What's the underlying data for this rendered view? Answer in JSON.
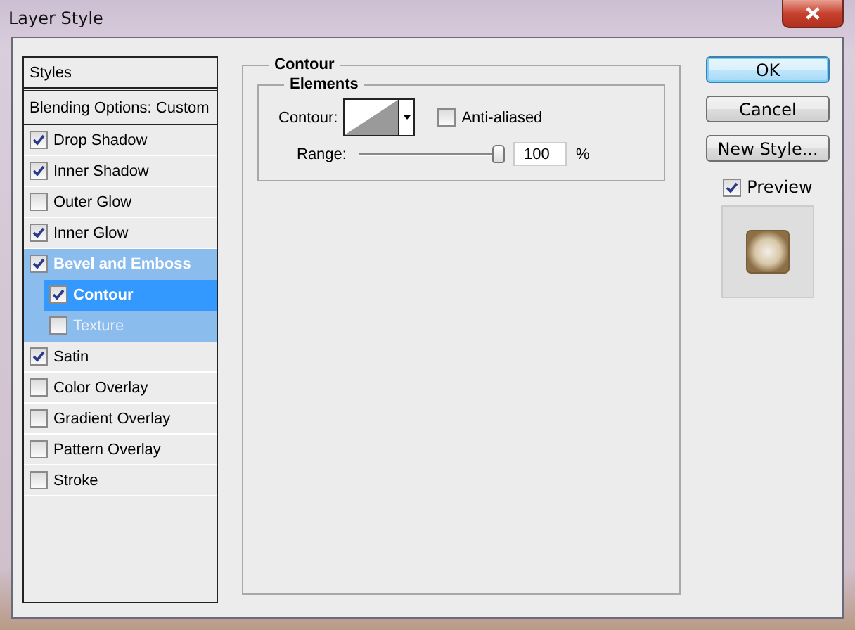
{
  "window": {
    "title": "Layer Style"
  },
  "styles_panel": {
    "header": "Styles",
    "blending_options": "Blending Options: Custom",
    "items": [
      {
        "label": "Drop Shadow",
        "checked": true,
        "selected": false
      },
      {
        "label": "Inner Shadow",
        "checked": true,
        "selected": false
      },
      {
        "label": "Outer Glow",
        "checked": false,
        "selected": false
      },
      {
        "label": "Inner Glow",
        "checked": true,
        "selected": false
      },
      {
        "label": "Bevel and Emboss",
        "checked": true,
        "selected": false,
        "children": [
          {
            "label": "Contour",
            "checked": true,
            "selected": true
          },
          {
            "label": "Texture",
            "checked": false,
            "selected": false
          }
        ]
      },
      {
        "label": "Satin",
        "checked": true,
        "selected": false
      },
      {
        "label": "Color Overlay",
        "checked": false,
        "selected": false
      },
      {
        "label": "Gradient Overlay",
        "checked": false,
        "selected": false
      },
      {
        "label": "Pattern Overlay",
        "checked": false,
        "selected": false
      },
      {
        "label": "Stroke",
        "checked": false,
        "selected": false
      }
    ]
  },
  "contour_panel": {
    "title": "Contour",
    "elements": {
      "title": "Elements",
      "contour_label": "Contour:",
      "anti_aliased": {
        "label": "Anti-aliased",
        "checked": false
      },
      "range": {
        "label": "Range:",
        "level": 1.0,
        "value": "100",
        "unit": "%"
      }
    }
  },
  "buttons": [
    {
      "label": "OK",
      "default": true
    },
    {
      "label": "Cancel",
      "default": false
    },
    {
      "label": "New Style...",
      "default": false
    }
  ],
  "preview": {
    "label": "Preview",
    "checked": true
  }
}
